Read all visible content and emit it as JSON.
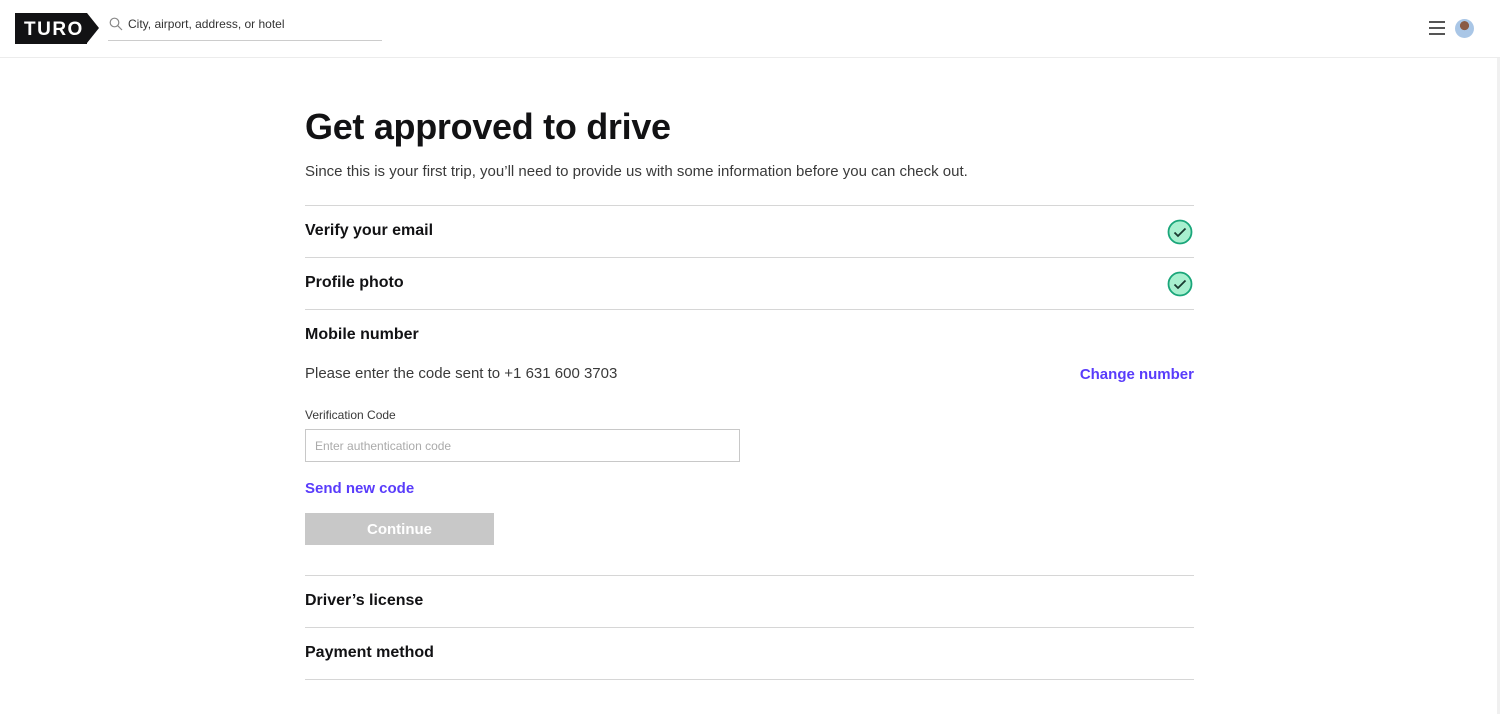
{
  "header": {
    "logo_text": "TURO",
    "search_placeholder": "City, airport, address, or hotel"
  },
  "page": {
    "title": "Get approved to drive",
    "subtitle": "Since this is your first trip, you’ll need to provide us with some information before you can check out."
  },
  "steps": [
    {
      "label": "Verify your email",
      "status": "complete"
    },
    {
      "label": "Profile photo",
      "status": "complete"
    },
    {
      "label": "Mobile number",
      "status": "active"
    },
    {
      "label": "Driver’s license",
      "status": "pending"
    },
    {
      "label": "Payment method",
      "status": "pending"
    }
  ],
  "mobile": {
    "instruction": "Please enter the code sent to +1 631 600 3703",
    "change_number": "Change number",
    "field_label": "Verification Code",
    "field_placeholder": "Enter authentication code",
    "field_value": "",
    "send_new_code": "Send new code",
    "continue": "Continue"
  },
  "colors": {
    "accent": "#593cfb",
    "check": "#1aa67a",
    "check_fill": "#a8f0cf",
    "disabled": "#c8c8c8"
  }
}
